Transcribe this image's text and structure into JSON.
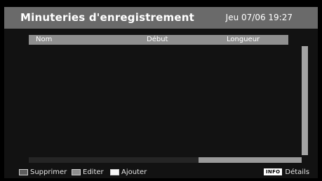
{
  "header": {
    "title": "Minuteries d'enregistrement",
    "datetime": "Jeu 07/06 19:27"
  },
  "table": {
    "columns": [
      "Nom",
      "Début",
      "Longueur"
    ],
    "rows": []
  },
  "footer": {
    "delete_label": "Supprimer",
    "edit_label": "Editer",
    "add_label": "Ajouter",
    "info_key": "INFO",
    "details_label": "Détails"
  },
  "colors": {
    "title_bar": "#6a6a6a",
    "header_row": "#8f8f8f",
    "background": "#121212",
    "delete_swatch": "#5e5e5e",
    "edit_swatch": "#8f8f8f",
    "add_swatch": "#f5f5f5"
  }
}
